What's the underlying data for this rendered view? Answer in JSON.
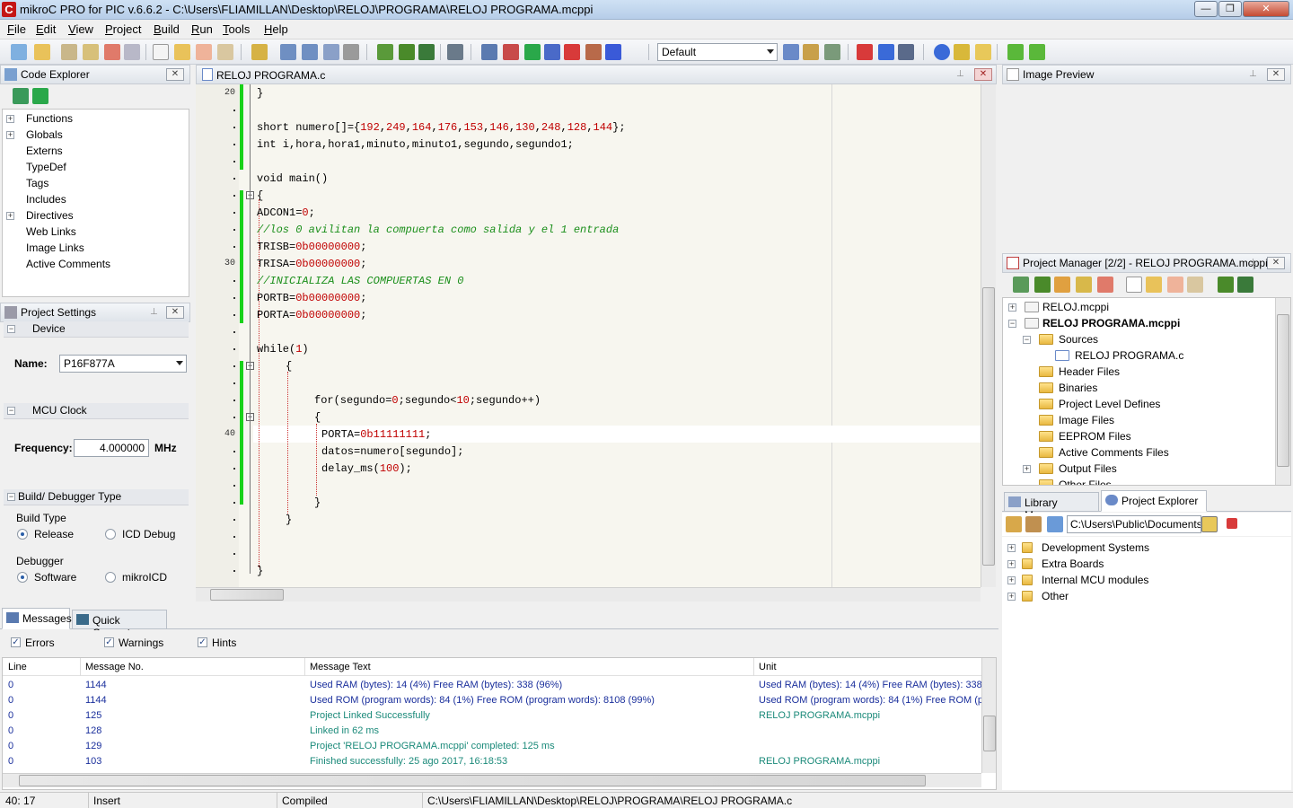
{
  "window": {
    "title": "mikroC PRO for PIC v.6.6.2 - C:\\Users\\FLIAMILLAN\\Desktop\\RELOJ\\PROGRAMA\\RELOJ PROGRAMA.mcppi",
    "app_icon": "C",
    "min": "—",
    "max": "❐",
    "close": "✕"
  },
  "menu": [
    {
      "u": "F",
      "rest": "ile"
    },
    {
      "u": "E",
      "rest": "dit"
    },
    {
      "u": "V",
      "rest": "iew"
    },
    {
      "u": "P",
      "rest": "roject"
    },
    {
      "u": "B",
      "rest": "uild"
    },
    {
      "u": "R",
      "rest": "un"
    },
    {
      "u": "T",
      "rest": "ools"
    },
    {
      "u": "H",
      "rest": "elp"
    }
  ],
  "toolbar": {
    "scheme_value": "Default"
  },
  "code_explorer": {
    "title": "Code Explorer",
    "items": [
      "Functions",
      "Globals",
      "Externs",
      "TypeDef",
      "Tags",
      "Includes",
      "Directives",
      "Web Links",
      "Image Links",
      "Active Comments"
    ]
  },
  "project_settings": {
    "title": "Project Settings",
    "device_label": "Device",
    "name_label": "Name:",
    "name_value": "P16F877A",
    "mcu_clock_label": "MCU Clock",
    "frequency_label": "Frequency:",
    "frequency_value": "4.000000",
    "frequency_unit": "MHz",
    "build_debugger_label": "Build/ Debugger Type",
    "build_type_label": "Build Type",
    "release_label": "Release",
    "icd_label": "ICD Debug",
    "debugger_label": "Debugger",
    "software_label": "Software",
    "mikroicd_label": "mikroICD"
  },
  "editor": {
    "tab_title": "RELOJ PROGRAMA.c",
    "line_numbers": {
      "l20": "20",
      "l30": "30",
      "l40": "40"
    }
  },
  "code": {
    "l1": "}",
    "l3a": "short numero[]={",
    "l3nums": [
      "192",
      "249",
      "164",
      "176",
      "153",
      "146",
      "130",
      "248",
      "128",
      "144"
    ],
    "l3b": "};",
    "l4": "int i,hora,hora1,minuto,minuto1,segundo,segundo1;",
    "l6": "void main()",
    "l7": "{",
    "l8a": "ADCON1=",
    "l8n": "0",
    "l8b": ";",
    "l9": "//los 0 avilitan la compuerta como salida y el 1 entrada",
    "l10a": "TRISB=",
    "l10n": "0b00000000",
    "l10b": ";",
    "l11a": "TRISA=",
    "l11n": "0b00000000",
    "l11b": ";",
    "l12": "//INICIALIZA LAS COMPUERTAS EN 0",
    "l13a": "PORTB=",
    "l13n": "0b00000000",
    "l13b": ";",
    "l14a": "PORTA=",
    "l14n": "0b00000000",
    "l14b": ";",
    "l16a": "while(",
    "l16n": "1",
    "l16b": ")",
    "l17": "{",
    "l20a": "for(segundo=",
    "l20n1": "0",
    "l20b": ";segundo<",
    "l20n2": "10",
    "l20c": ";segundo++)",
    "l21": "{",
    "l22a": "PORTA=",
    "l22n": "0b11111111",
    "l22b": ";",
    "l23": "datos=numero[segundo];",
    "l24a": "delay_ms(",
    "l24n": "100",
    "l24b": ");",
    "l26": "}",
    "l27": "}",
    "l30": "}"
  },
  "image_preview": {
    "title": "Image Preview"
  },
  "project_manager": {
    "title": "Project Manager [2/2] - RELOJ PROGRAMA.mcppi",
    "items": [
      {
        "label": "RELOJ.mcppi"
      },
      {
        "label": "RELOJ PROGRAMA.mcppi"
      },
      {
        "label": "Sources"
      },
      {
        "label": "RELOJ PROGRAMA.c"
      },
      {
        "label": "Header Files"
      },
      {
        "label": "Binaries"
      },
      {
        "label": "Project Level Defines"
      },
      {
        "label": "Image Files"
      },
      {
        "label": "EEPROM Files"
      },
      {
        "label": "Active Comments Files"
      },
      {
        "label": "Output Files"
      },
      {
        "label": "Other Files"
      }
    ]
  },
  "bottom_right_tabs": {
    "library": "Library Manager",
    "project_explorer": "Project Explorer"
  },
  "project_explorer": {
    "path": "C:\\Users\\Public\\Documents\\Mil",
    "items": [
      "Development Systems",
      "Extra Boards",
      "Internal MCU modules",
      "Other"
    ]
  },
  "messages": {
    "tab_messages": "Messages",
    "tab_quick": "Quick Converter",
    "errors_label": "Errors",
    "warnings_label": "Warnings",
    "hints_label": "Hints",
    "col_line": "Line",
    "col_msgno": "Message No.",
    "col_text": "Message Text",
    "col_unit": "Unit",
    "rows": [
      {
        "line": "0",
        "no": "1144",
        "text": "Used RAM (bytes): 14 (4%)  Free RAM (bytes): 338 (96%)",
        "unit": "Used RAM (bytes): 14 (4%)  Free RAM (bytes): 338"
      },
      {
        "line": "0",
        "no": "1144",
        "text": "Used ROM (program words): 84 (1%)  Free ROM (program words): 8108 (99%)",
        "unit": "Used ROM (program words): 84 (1%)  Free ROM (p"
      },
      {
        "line": "0",
        "no": "125",
        "text": "Project Linked Successfully",
        "unit": "RELOJ PROGRAMA.mcppi"
      },
      {
        "line": "0",
        "no": "128",
        "text": "Linked in 62 ms",
        "unit": ""
      },
      {
        "line": "0",
        "no": "129",
        "text": "Project 'RELOJ PROGRAMA.mcppi' completed: 125 ms",
        "unit": ""
      },
      {
        "line": "0",
        "no": "103",
        "text": "Finished successfully: 25 ago 2017, 16:18:53",
        "unit": "RELOJ PROGRAMA.mcppi"
      }
    ]
  },
  "status": {
    "pos": "40: 17",
    "mode": "Insert",
    "state": "Compiled",
    "path": "C:\\Users\\FLIAMILLAN\\Desktop\\RELOJ\\PROGRAMA\\RELOJ PROGRAMA.c"
  },
  "colors": {
    "row_blue": "#1a2f9c",
    "row_green": "#1b8a7a",
    "change_bar": "#19d219"
  }
}
